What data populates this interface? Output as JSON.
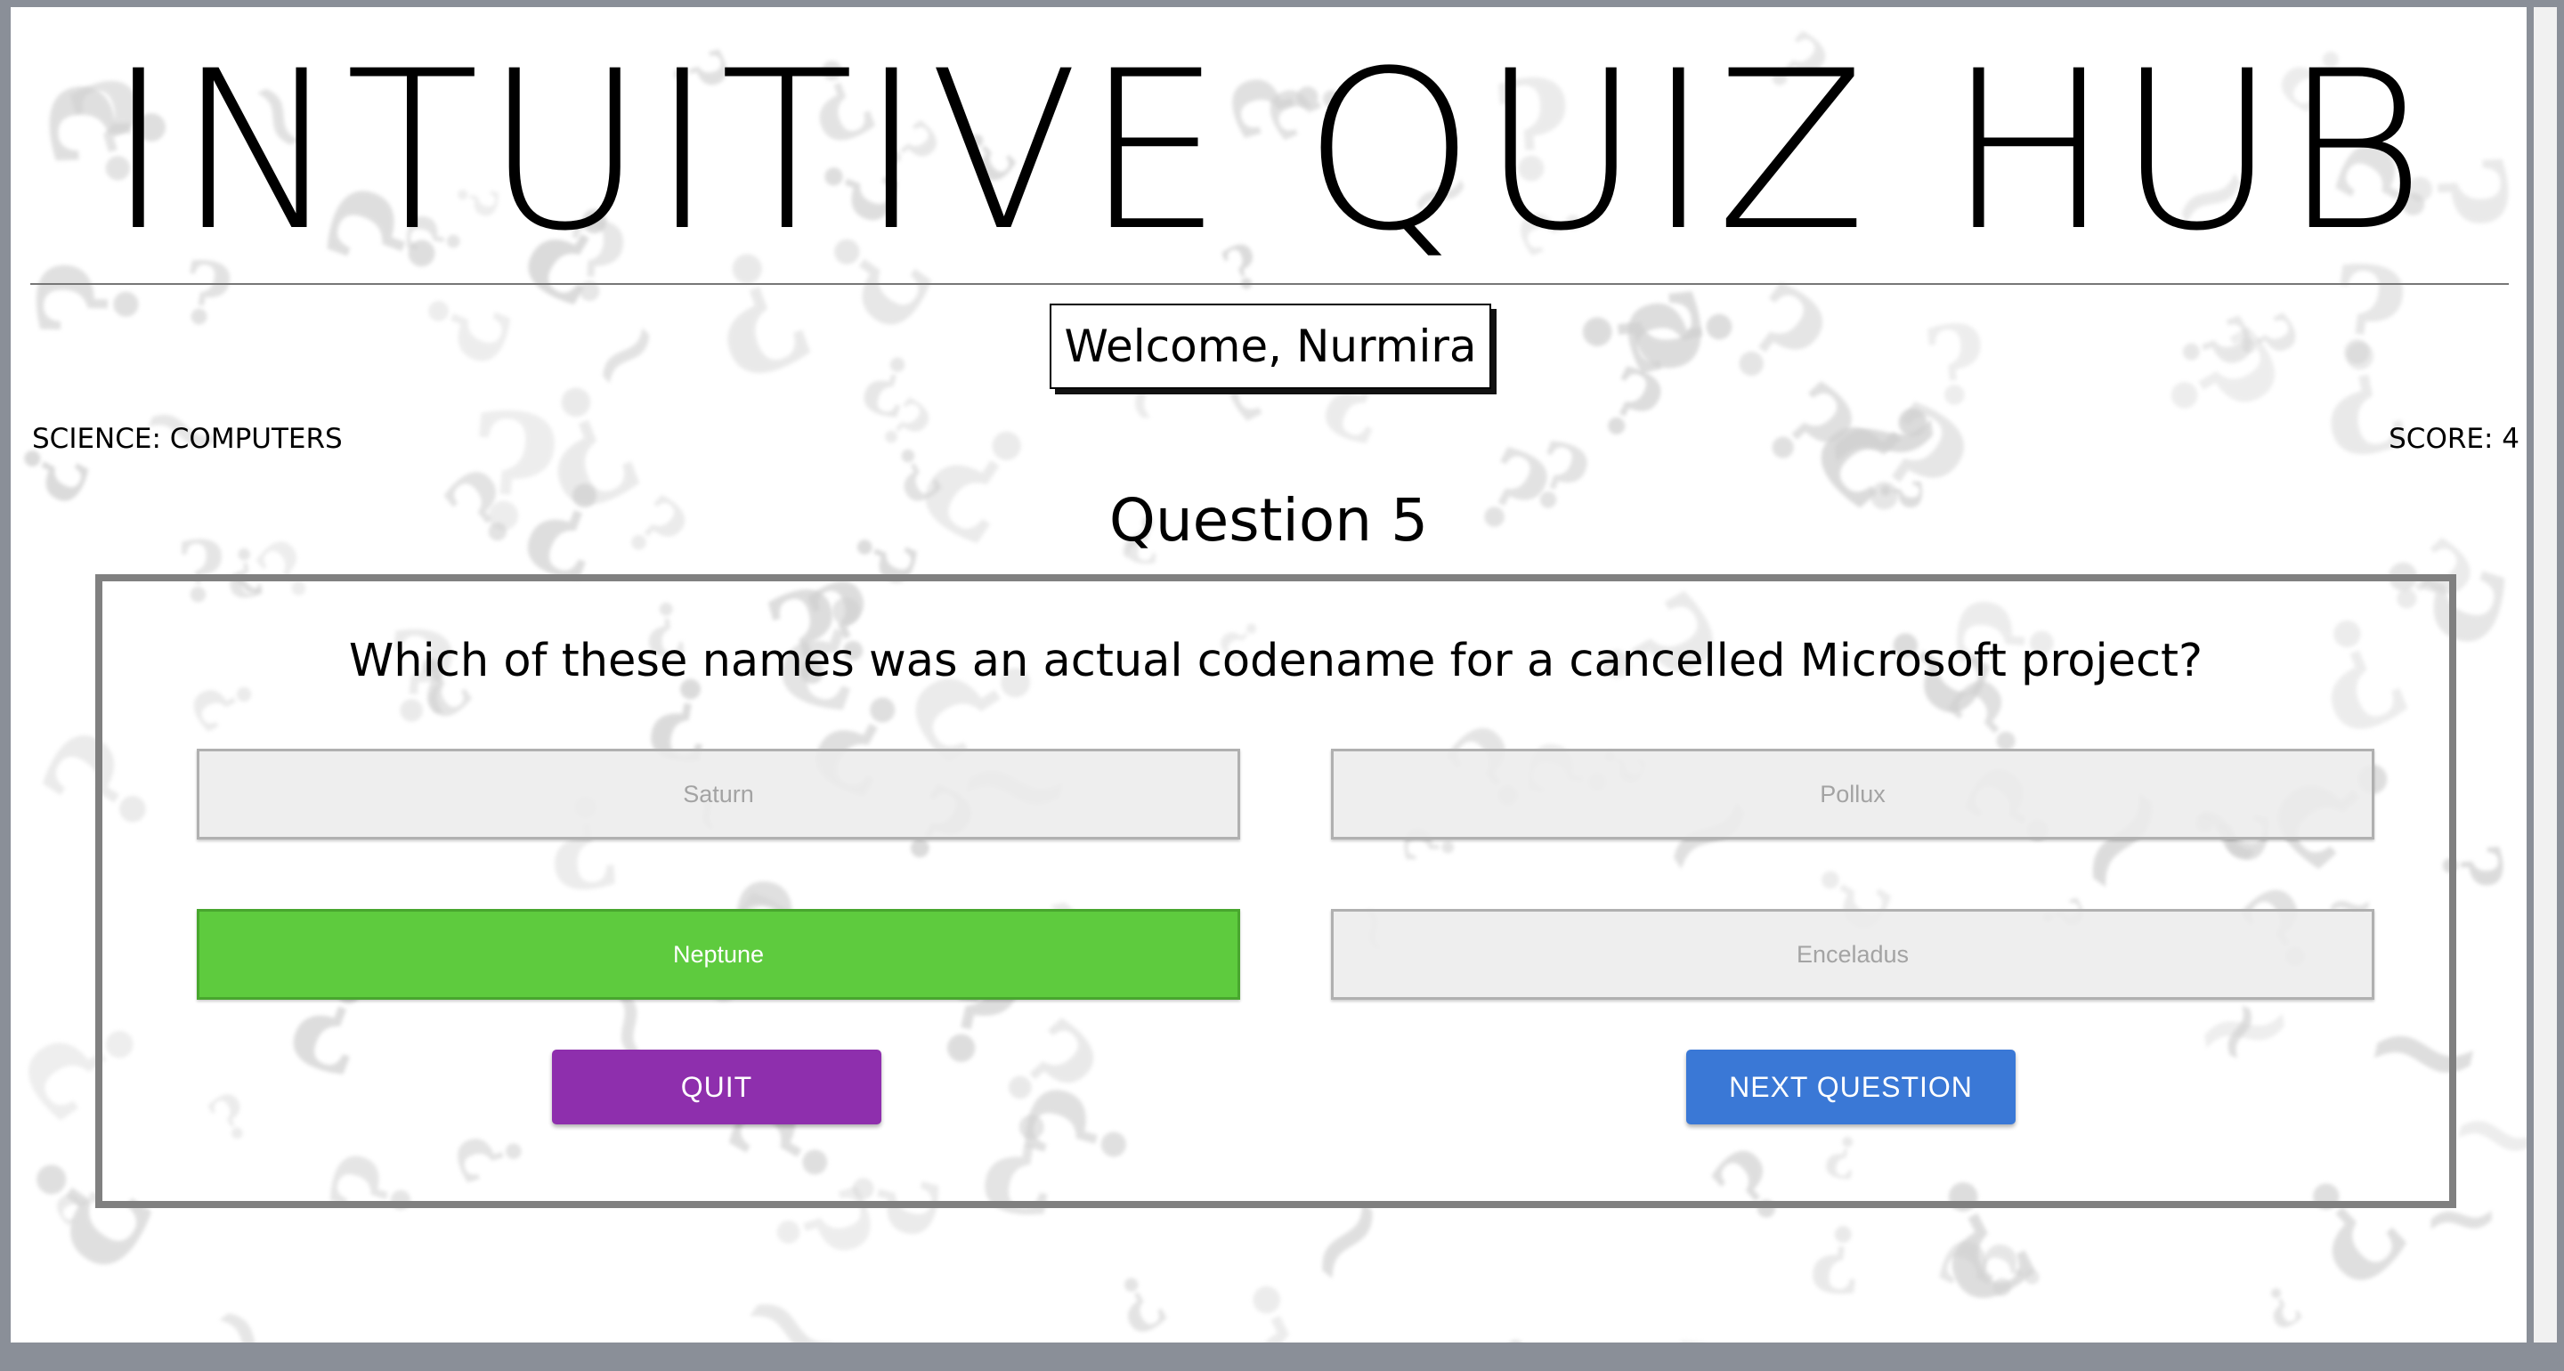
{
  "header": {
    "title": "INTUITIVE QUIZ HUB",
    "welcome": "Welcome, Nurmira"
  },
  "status": {
    "category": "SCIENCE: COMPUTERS",
    "score": "SCORE: 4"
  },
  "quiz": {
    "question_number": "Question 5",
    "question": "Which of these names was an actual codename for a cancelled Microsoft project?",
    "answers": [
      {
        "label": "Saturn",
        "selected": false
      },
      {
        "label": "Pollux",
        "selected": false
      },
      {
        "label": "Neptune",
        "selected": true
      },
      {
        "label": "Enceladus",
        "selected": false
      }
    ],
    "quit_label": "QUIT",
    "next_label": "NEXT QUESTION"
  },
  "colors": {
    "selected_answer": "#5ecb3e",
    "quit_button": "#8e2fad",
    "next_button": "#3a78d6",
    "card_border": "#808080"
  },
  "icons": {
    "background_pattern": "question-mark-pattern"
  }
}
